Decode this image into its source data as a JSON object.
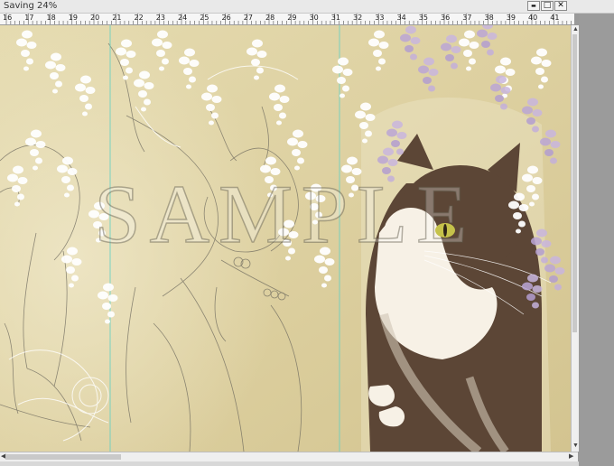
{
  "window": {
    "title": "Saving 24%",
    "minimize_glyph": "▬",
    "maximize_glyph": "□",
    "close_glyph": "✕"
  },
  "ruler": {
    "labels": [
      "16",
      "17",
      "18",
      "19",
      "20",
      "21",
      "22",
      "23",
      "24",
      "25",
      "26",
      "27",
      "28",
      "29",
      "30",
      "31",
      "32",
      "33",
      "34",
      "35",
      "36",
      "37",
      "38",
      "39",
      "40",
      "41"
    ]
  },
  "canvas": {
    "watermark": "SAMPLE"
  },
  "scrollbars": {
    "up_glyph": "▲",
    "down_glyph": "▼",
    "left_glyph": "◀",
    "right_glyph": "▶"
  }
}
